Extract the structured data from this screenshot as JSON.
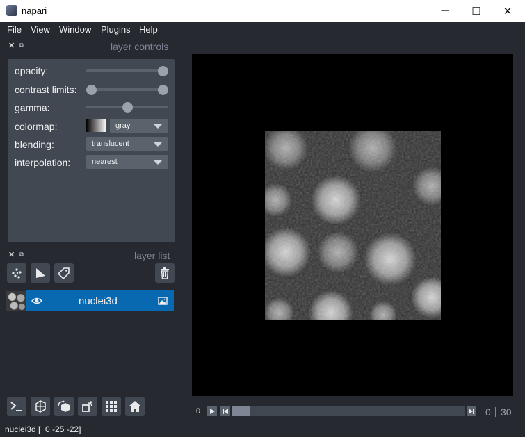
{
  "window": {
    "title": "napari",
    "minimize_glyph": "─",
    "maximize_glyph": "☐",
    "close_glyph": "✕"
  },
  "menu": [
    "File",
    "View",
    "Window",
    "Plugins",
    "Help"
  ],
  "layer_controls": {
    "title": "layer controls",
    "opacity_label": "opacity:",
    "opacity_value": 1.0,
    "contrast_label": "contrast limits:",
    "contrast_range": [
      0.0,
      1.0
    ],
    "gamma_label": "gamma:",
    "gamma_value": 0.5,
    "colormap_label": "colormap:",
    "colormap_value": "gray",
    "blending_label": "blending:",
    "blending_value": "translucent",
    "interpolation_label": "interpolation:",
    "interpolation_value": "nearest"
  },
  "layer_list": {
    "title": "layer list",
    "layers": [
      {
        "name": "nuclei3d",
        "visible": true,
        "type": "image"
      }
    ]
  },
  "dims": {
    "start_label": "0",
    "current": "0",
    "total": "30",
    "position_fraction": 0.0
  },
  "status": {
    "text": "nuclei3d [  0 -25 -22]"
  },
  "colors": {
    "bg": "#262930",
    "panel": "#414851",
    "accent": "#0868b0"
  }
}
